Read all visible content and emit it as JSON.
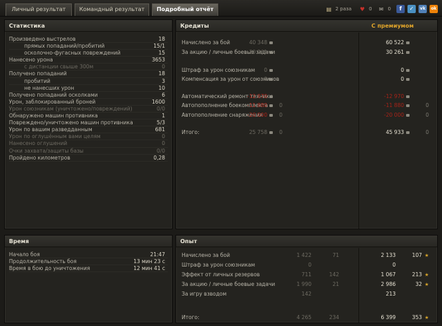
{
  "tabs": [
    {
      "label": "Личный результат"
    },
    {
      "label": "Командный результат"
    },
    {
      "label": "Подробный отчёт"
    }
  ],
  "topbar": {
    "folder_count": "2 раза",
    "likes": "0",
    "messages": "0",
    "share": [
      "f",
      "✓",
      "vk",
      "ok"
    ]
  },
  "stats": {
    "title": "Статистика",
    "rows": [
      {
        "label": "Произведено выстрелов",
        "value": "18",
        "indent": 0,
        "dim": false
      },
      {
        "label": "прямых попаданий/пробитий",
        "value": "15/1",
        "indent": 1,
        "dim": false
      },
      {
        "label": "осколочно-фугасных повреждений",
        "value": "15",
        "indent": 1,
        "dim": false
      },
      {
        "label": "Нанесено урона",
        "value": "3653",
        "indent": 0,
        "dim": false
      },
      {
        "label": "с дистанции свыше 300м",
        "value": "0",
        "indent": 1,
        "dim": true
      },
      {
        "label": "Получено попаданий",
        "value": "18",
        "indent": 0,
        "dim": false
      },
      {
        "label": "пробитий",
        "value": "3",
        "indent": 1,
        "dim": false
      },
      {
        "label": "не нанесших урон",
        "value": "10",
        "indent": 1,
        "dim": false
      },
      {
        "label": "Получено попаданий осколками",
        "value": "6",
        "indent": 0,
        "dim": false
      },
      {
        "label": "Урон, заблокированный броней",
        "value": "1600",
        "indent": 0,
        "dim": false
      },
      {
        "label": "Урон союзникам (уничтожено/повреждений)",
        "value": "0/0",
        "indent": 0,
        "dim": true
      },
      {
        "label": "Обнаружено машин противника",
        "value": "1",
        "indent": 0,
        "dim": false
      },
      {
        "label": "Повреждено/уничтожено машин противника",
        "value": "5/3",
        "indent": 0,
        "dim": false
      },
      {
        "label": "Урон по вашим разведданным",
        "value": "681",
        "indent": 0,
        "dim": false
      },
      {
        "label": "Урон по оглушённым вами целям",
        "value": "0",
        "indent": 0,
        "dim": true
      },
      {
        "label": "Нанесено оглушений",
        "value": "0",
        "indent": 0,
        "dim": true
      },
      {
        "label": "Очки захвата/защиты базы",
        "value": "0/0",
        "indent": 0,
        "dim": true
      },
      {
        "label": "Пройдено километров",
        "value": "0,28",
        "indent": 0,
        "dim": false
      }
    ]
  },
  "time": {
    "title": "Время",
    "rows": [
      {
        "label": "Начало боя",
        "value": "21:47"
      },
      {
        "label": "Продолжительность боя",
        "value": "13 мин 23 с"
      },
      {
        "label": "Время в бою до уничтожения",
        "value": "12 мин 41 с"
      }
    ]
  },
  "credits": {
    "title": "Кредиты",
    "premium_title": "С премиумом",
    "rows": [
      {
        "label": "Начислено за бой",
        "base": "40 348",
        "base2": "",
        "prem": "60 522",
        "prem2": "",
        "red": false
      },
      {
        "label": "За акцию / личные боевые задачи",
        "base": "30 261",
        "base2": "",
        "prem": "30 261",
        "prem2": "",
        "red": false
      },
      {
        "label": "Штраф за урон союзникам",
        "base": "0",
        "base2": "",
        "prem": "0",
        "prem2": "",
        "red": false
      },
      {
        "label": "Компенсация за урон от союзников",
        "base": "0",
        "base2": "",
        "prem": "0",
        "prem2": "",
        "red": false
      },
      {
        "label": "Автоматический ремонт техники",
        "base": "-12 970",
        "base2": "",
        "prem": "-12 970",
        "prem2": "",
        "red": true
      },
      {
        "label": "Автопополнение боекомплекта",
        "base": "-11 880",
        "base2": "0",
        "prem": "-11 880",
        "prem2": "0",
        "red": true
      },
      {
        "label": "Автопополнение снаряжения",
        "base": "-20 000",
        "base2": "0",
        "prem": "-20 000",
        "prem2": "0",
        "red": true
      },
      {
        "label": "Итого:",
        "base": "25 758",
        "base2": "0",
        "prem": "45 933",
        "prem2": "0",
        "red": false
      }
    ]
  },
  "experience": {
    "title": "Опыт",
    "rows": [
      {
        "label": "Начислено за бой",
        "v1": "1 422",
        "v2": "71",
        "v3": "2 133",
        "v4": "107"
      },
      {
        "label": "Штраф за урон союзникам",
        "v1": "0",
        "v2": "",
        "v3": "0",
        "v4": ""
      },
      {
        "label": "Эффект от личных резервов",
        "v1": "711",
        "v2": "142",
        "v3": "1 067",
        "v4": "213"
      },
      {
        "label": "За акцию / личные боевые задачи",
        "v1": "1 990",
        "v2": "21",
        "v3": "2 986",
        "v4": "32"
      },
      {
        "label": "За игру взводом",
        "v1": "142",
        "v2": "",
        "v3": "213",
        "v4": ""
      },
      {
        "label": "Итого:",
        "v1": "4 265",
        "v2": "234",
        "v3": "6 399",
        "v4": "353"
      }
    ]
  }
}
